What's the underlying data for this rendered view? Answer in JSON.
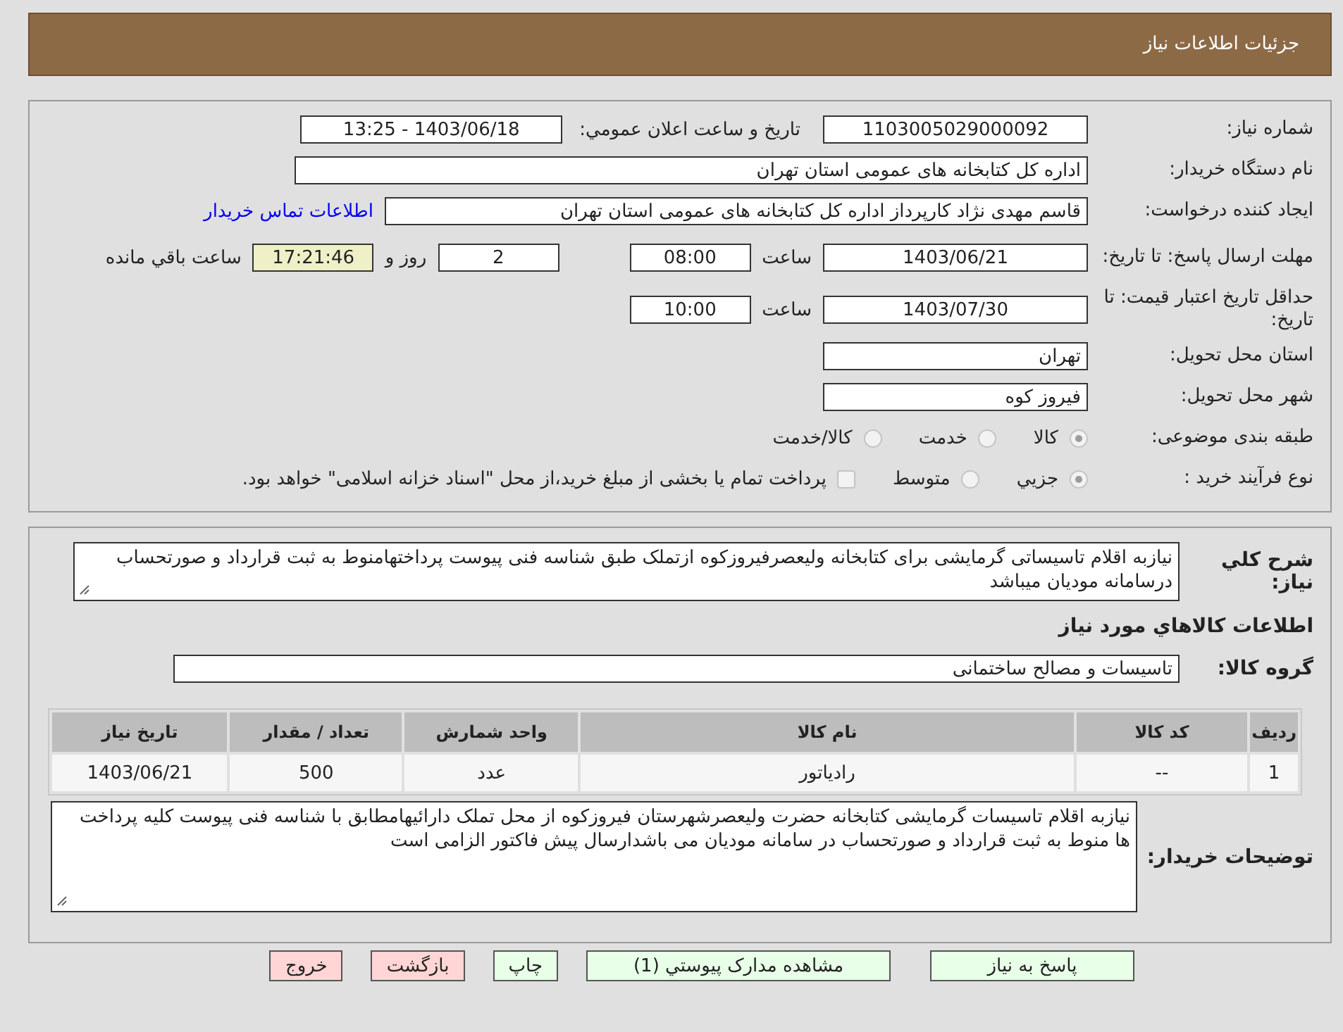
{
  "header": {
    "title": "جزئیات اطلاعات نیاز"
  },
  "need_number": {
    "label": "شماره نیاز:",
    "value": "1103005029000092"
  },
  "announce": {
    "label": "تاریخ و ساعت اعلان عمومي:",
    "value": "1403/06/18 - 13:25"
  },
  "buyer_org": {
    "label": "نام دستگاه خریدار:",
    "value": "اداره کل کتابخانه های عمومی استان تهران"
  },
  "requester": {
    "label": "ایجاد کننده درخواست:",
    "value": "قاسم مهدی نژاد کارپرداز اداره کل کتابخانه های عمومی استان تهران",
    "contact_link": "اطلاعات تماس خریدار"
  },
  "deadline": {
    "label": "مهلت ارسال پاسخ: تا تاریخ:",
    "date": "1403/06/21",
    "time_label": "ساعت",
    "time": "08:00",
    "days": "2",
    "days_label": "روز و",
    "remaining": "17:21:46",
    "remaining_label": "ساعت باقي مانده"
  },
  "validity": {
    "label": "حداقل تاریخ اعتبار قیمت: تا تاریخ:",
    "date": "1403/07/30",
    "time_label": "ساعت",
    "time": "10:00"
  },
  "province": {
    "label": "استان محل تحویل:",
    "value": "تهران"
  },
  "city": {
    "label": "شهر محل تحویل:",
    "value": "فیروز کوه"
  },
  "category": {
    "label": "طبقه بندی موضوعی:",
    "options": [
      {
        "label": "کالا",
        "selected": true
      },
      {
        "label": "خدمت",
        "selected": false
      },
      {
        "label": "کالا/خدمت",
        "selected": false
      }
    ]
  },
  "purchase_type": {
    "label": "نوع فرآیند خرید :",
    "options": [
      {
        "label": "جزيي",
        "selected": true
      },
      {
        "label": "متوسط",
        "selected": false
      }
    ],
    "payment_note": {
      "checked": false,
      "text": "پرداخت تمام یا بخشی از مبلغ خرید،از محل \"اسناد خزانه اسلامی\" خواهد بود."
    }
  },
  "description": {
    "label": "شرح کلي نياز:",
    "text": "نیازبه اقلام تاسیساتی گرمایشی برای کتابخانه ولیعصرفیروزکوه ازتملک طبق شناسه فنی پیوست پرداختهامنوط به ثبت قرارداد و صورتحساب درسامانه مودیان میباشد"
  },
  "goods_section_title": "اطلاعات کالاهاي مورد نياز",
  "goods_group": {
    "label": "گروه کالا:",
    "value": "تاسیسات و مصالح ساختمانی"
  },
  "table": {
    "columns": [
      "ردیف",
      "کد کالا",
      "نام کالا",
      "واحد شمارش",
      "تعداد / مقدار",
      "تاریخ نیاز"
    ],
    "rows": [
      [
        "1",
        "--",
        "رادیاتور",
        "عدد",
        "500",
        "1403/06/21"
      ]
    ]
  },
  "buyer_notes": {
    "label": "توضیحات خریدار:",
    "text": "نیازبه اقلام تاسیسات گرمایشی کتابخانه حضرت ولیعصرشهرستان فیروزکوه از محل تملک دارائیهامطابق با شناسه فنی پیوست کلیه پرداخت ها منوط به ثبت قرارداد و صورتحساب در سامانه مودیان می باشدارسال پیش فاکتور الزامی است"
  },
  "buttons": [
    {
      "label": "پاسخ به نیاز",
      "kind": "primary"
    },
    {
      "label": "مشاهده مدارک پیوستي (1)",
      "kind": "primary"
    },
    {
      "label": "چاپ",
      "kind": "primary"
    },
    {
      "label": "بازگشت",
      "kind": "danger"
    },
    {
      "label": "خروج",
      "kind": "danger"
    }
  ]
}
